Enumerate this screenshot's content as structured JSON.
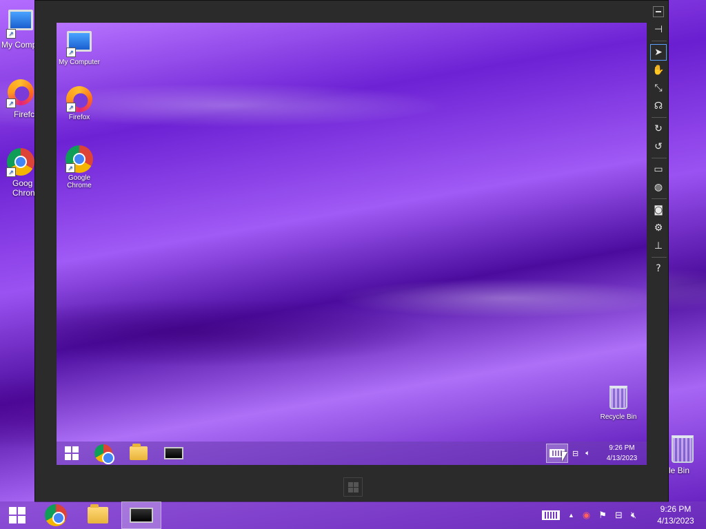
{
  "desktop": {
    "icons": [
      {
        "label": "My Computer",
        "icon": "computer-icon"
      },
      {
        "label": "Firefox",
        "icon": "firefox-icon"
      },
      {
        "label": "Google Chrome",
        "icon": "chrome-icon"
      },
      {
        "label": "Recycle Bin",
        "icon": "recycle-bin-icon"
      }
    ],
    "partial_labels": {
      "my_computer": "My Comp",
      "firefox": "Firefc",
      "chrome_line1": "Goog",
      "chrome_line2": "Chron",
      "recycle": "cle Bin"
    }
  },
  "remote": {
    "icons": [
      {
        "label": "My Computer"
      },
      {
        "label": "Firefox"
      },
      {
        "label": "Google Chrome"
      },
      {
        "label": "Recycle Bin"
      }
    ],
    "taskbar": {
      "time": "9:26 PM",
      "date": "4/13/2023"
    },
    "toolbar": [
      {
        "name": "pin-icon",
        "glyph": "⊣"
      },
      {
        "name": "pointer-tool-icon",
        "glyph": "➤",
        "selected": true
      },
      {
        "name": "hand-tool-icon",
        "glyph": "✋"
      },
      {
        "name": "fit-screen-icon",
        "glyph": "⤡"
      },
      {
        "name": "audio-icon",
        "glyph": "☊"
      },
      {
        "name": "rotate-right-icon",
        "glyph": "↻"
      },
      {
        "name": "rotate-left-icon",
        "glyph": "↺"
      },
      {
        "name": "display-icon",
        "glyph": "▭"
      },
      {
        "name": "globe-icon",
        "glyph": "◍"
      },
      {
        "name": "camera-icon",
        "glyph": "◙"
      },
      {
        "name": "settings-icon",
        "glyph": "⚙"
      },
      {
        "name": "network-icon",
        "glyph": "⊥"
      },
      {
        "name": "help-icon",
        "glyph": "?"
      }
    ]
  },
  "taskbar": {
    "time": "9:26 PM",
    "date": "4/13/2023"
  }
}
